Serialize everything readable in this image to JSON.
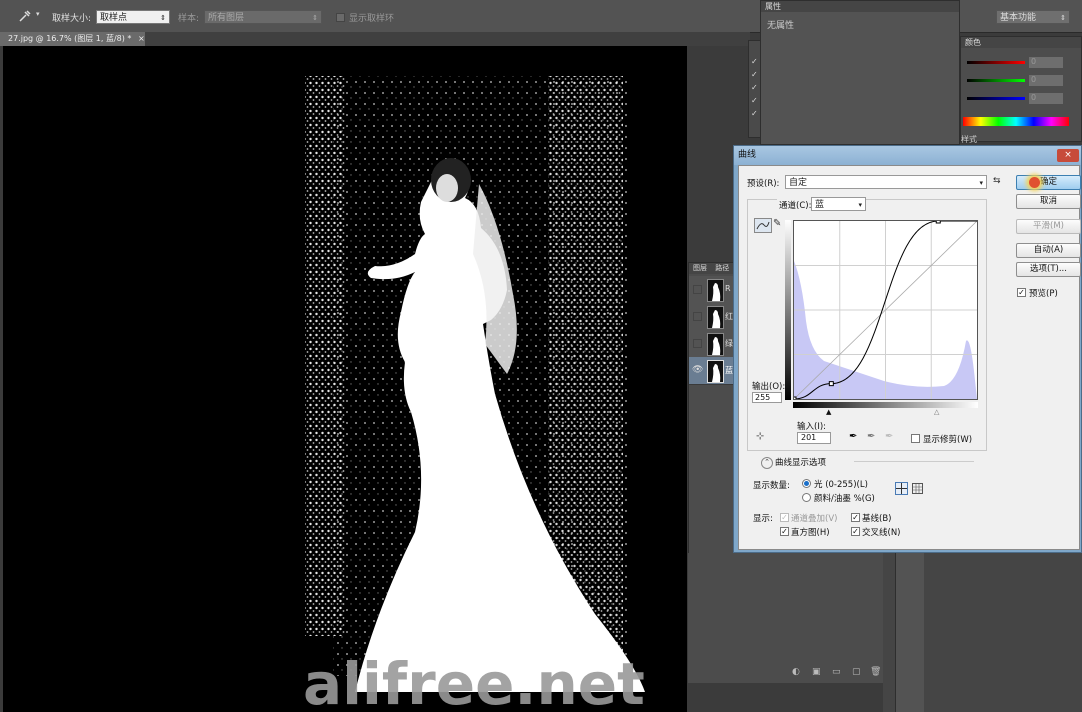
{
  "options_bar": {
    "sample_size_label": "取样大小:",
    "sample_size_value": "取样点",
    "sample_label": "样本:",
    "sample_value": "所有图层",
    "show_ring_label": "显示取样环",
    "workspace_value": "基本功能"
  },
  "document_tab": {
    "title": "27.jpg @ 16.7% (图层 1, 蓝/8) *",
    "close": "×"
  },
  "properties_panel": {
    "title": "属性",
    "content": "无属性"
  },
  "layers_panel": {
    "tab1": "图层",
    "tab2": "路径",
    "rows": [
      {
        "label": "R",
        "visible": false
      },
      {
        "label": "红",
        "visible": false
      },
      {
        "label": "绿",
        "visible": false
      },
      {
        "label": "蓝",
        "visible": true
      }
    ]
  },
  "color_panel": {
    "tab": "颜色",
    "values": [
      "0",
      "0",
      "0"
    ],
    "styles_tab": "样式"
  },
  "curves_dialog": {
    "title": "曲线",
    "preset_label": "预设(R):",
    "preset_value": "自定",
    "channel_label": "通道(C):",
    "channel_value": "蓝",
    "output_label": "输出(O):",
    "output_value": "255",
    "input_label": "输入(I):",
    "input_value": "201",
    "show_clipping_label": "显示修剪(W)",
    "curve_display_options": "曲线显示选项",
    "show_amount_label": "显示数量:",
    "light_option": "光 (0-255)(L)",
    "pigment_option": "颜料/油墨 %(G)",
    "show_label": "显示:",
    "channel_overlay": "通道叠加(V)",
    "baseline": "基线(B)",
    "histogram": "直方图(H)",
    "intersection": "交叉线(N)",
    "buttons": {
      "ok": "确定",
      "cancel": "取消",
      "smooth": "平滑(M)",
      "auto": "自动(A)",
      "options": "选项(T)...",
      "preview": "预览(P)"
    },
    "curve_points": [
      [
        0,
        0
      ],
      [
        52,
        22
      ],
      [
        201,
        255
      ]
    ]
  },
  "watermark": "alifree.net",
  "colors": {
    "ps_dark": "#3b3b3b",
    "ps_panel": "#535353",
    "dialog_frame": "#7fa7c9",
    "histogram_fill": "#c8c8f5",
    "ok_highlight": "#6fb0e6"
  }
}
